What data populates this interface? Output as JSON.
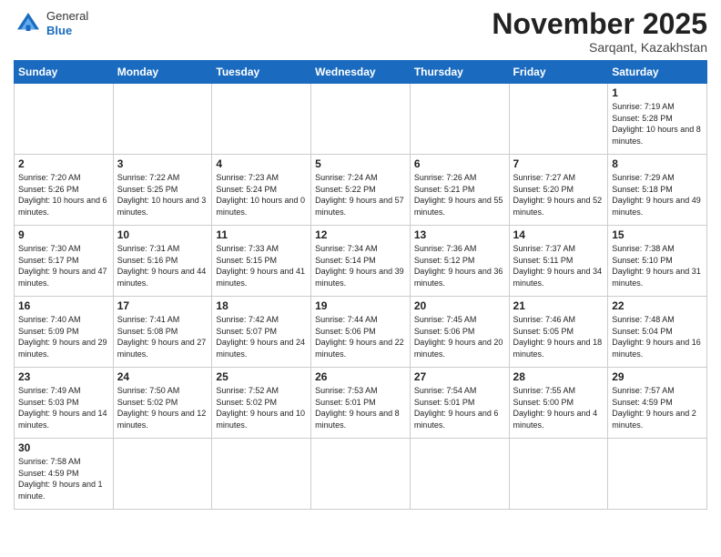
{
  "header": {
    "logo": {
      "general": "General",
      "blue": "Blue"
    },
    "title": "November 2025",
    "location": "Sarqant, Kazakhstan"
  },
  "weekdays": [
    "Sunday",
    "Monday",
    "Tuesday",
    "Wednesday",
    "Thursday",
    "Friday",
    "Saturday"
  ],
  "weeks": [
    [
      {
        "day": "",
        "info": ""
      },
      {
        "day": "",
        "info": ""
      },
      {
        "day": "",
        "info": ""
      },
      {
        "day": "",
        "info": ""
      },
      {
        "day": "",
        "info": ""
      },
      {
        "day": "",
        "info": ""
      },
      {
        "day": "1",
        "info": "Sunrise: 7:19 AM\nSunset: 5:28 PM\nDaylight: 10 hours\nand 8 minutes."
      }
    ],
    [
      {
        "day": "2",
        "info": "Sunrise: 7:20 AM\nSunset: 5:26 PM\nDaylight: 10 hours\nand 6 minutes."
      },
      {
        "day": "3",
        "info": "Sunrise: 7:22 AM\nSunset: 5:25 PM\nDaylight: 10 hours\nand 3 minutes."
      },
      {
        "day": "4",
        "info": "Sunrise: 7:23 AM\nSunset: 5:24 PM\nDaylight: 10 hours\nand 0 minutes."
      },
      {
        "day": "5",
        "info": "Sunrise: 7:24 AM\nSunset: 5:22 PM\nDaylight: 9 hours\nand 57 minutes."
      },
      {
        "day": "6",
        "info": "Sunrise: 7:26 AM\nSunset: 5:21 PM\nDaylight: 9 hours\nand 55 minutes."
      },
      {
        "day": "7",
        "info": "Sunrise: 7:27 AM\nSunset: 5:20 PM\nDaylight: 9 hours\nand 52 minutes."
      },
      {
        "day": "8",
        "info": "Sunrise: 7:29 AM\nSunset: 5:18 PM\nDaylight: 9 hours\nand 49 minutes."
      }
    ],
    [
      {
        "day": "9",
        "info": "Sunrise: 7:30 AM\nSunset: 5:17 PM\nDaylight: 9 hours\nand 47 minutes."
      },
      {
        "day": "10",
        "info": "Sunrise: 7:31 AM\nSunset: 5:16 PM\nDaylight: 9 hours\nand 44 minutes."
      },
      {
        "day": "11",
        "info": "Sunrise: 7:33 AM\nSunset: 5:15 PM\nDaylight: 9 hours\nand 41 minutes."
      },
      {
        "day": "12",
        "info": "Sunrise: 7:34 AM\nSunset: 5:14 PM\nDaylight: 9 hours\nand 39 minutes."
      },
      {
        "day": "13",
        "info": "Sunrise: 7:36 AM\nSunset: 5:12 PM\nDaylight: 9 hours\nand 36 minutes."
      },
      {
        "day": "14",
        "info": "Sunrise: 7:37 AM\nSunset: 5:11 PM\nDaylight: 9 hours\nand 34 minutes."
      },
      {
        "day": "15",
        "info": "Sunrise: 7:38 AM\nSunset: 5:10 PM\nDaylight: 9 hours\nand 31 minutes."
      }
    ],
    [
      {
        "day": "16",
        "info": "Sunrise: 7:40 AM\nSunset: 5:09 PM\nDaylight: 9 hours\nand 29 minutes."
      },
      {
        "day": "17",
        "info": "Sunrise: 7:41 AM\nSunset: 5:08 PM\nDaylight: 9 hours\nand 27 minutes."
      },
      {
        "day": "18",
        "info": "Sunrise: 7:42 AM\nSunset: 5:07 PM\nDaylight: 9 hours\nand 24 minutes."
      },
      {
        "day": "19",
        "info": "Sunrise: 7:44 AM\nSunset: 5:06 PM\nDaylight: 9 hours\nand 22 minutes."
      },
      {
        "day": "20",
        "info": "Sunrise: 7:45 AM\nSunset: 5:06 PM\nDaylight: 9 hours\nand 20 minutes."
      },
      {
        "day": "21",
        "info": "Sunrise: 7:46 AM\nSunset: 5:05 PM\nDaylight: 9 hours\nand 18 minutes."
      },
      {
        "day": "22",
        "info": "Sunrise: 7:48 AM\nSunset: 5:04 PM\nDaylight: 9 hours\nand 16 minutes."
      }
    ],
    [
      {
        "day": "23",
        "info": "Sunrise: 7:49 AM\nSunset: 5:03 PM\nDaylight: 9 hours\nand 14 minutes."
      },
      {
        "day": "24",
        "info": "Sunrise: 7:50 AM\nSunset: 5:02 PM\nDaylight: 9 hours\nand 12 minutes."
      },
      {
        "day": "25",
        "info": "Sunrise: 7:52 AM\nSunset: 5:02 PM\nDaylight: 9 hours\nand 10 minutes."
      },
      {
        "day": "26",
        "info": "Sunrise: 7:53 AM\nSunset: 5:01 PM\nDaylight: 9 hours\nand 8 minutes."
      },
      {
        "day": "27",
        "info": "Sunrise: 7:54 AM\nSunset: 5:01 PM\nDaylight: 9 hours\nand 6 minutes."
      },
      {
        "day": "28",
        "info": "Sunrise: 7:55 AM\nSunset: 5:00 PM\nDaylight: 9 hours\nand 4 minutes."
      },
      {
        "day": "29",
        "info": "Sunrise: 7:57 AM\nSunset: 4:59 PM\nDaylight: 9 hours\nand 2 minutes."
      }
    ],
    [
      {
        "day": "30",
        "info": "Sunrise: 7:58 AM\nSunset: 4:59 PM\nDaylight: 9 hours\nand 1 minute."
      },
      {
        "day": "",
        "info": ""
      },
      {
        "day": "",
        "info": ""
      },
      {
        "day": "",
        "info": ""
      },
      {
        "day": "",
        "info": ""
      },
      {
        "day": "",
        "info": ""
      },
      {
        "day": "",
        "info": ""
      }
    ]
  ]
}
